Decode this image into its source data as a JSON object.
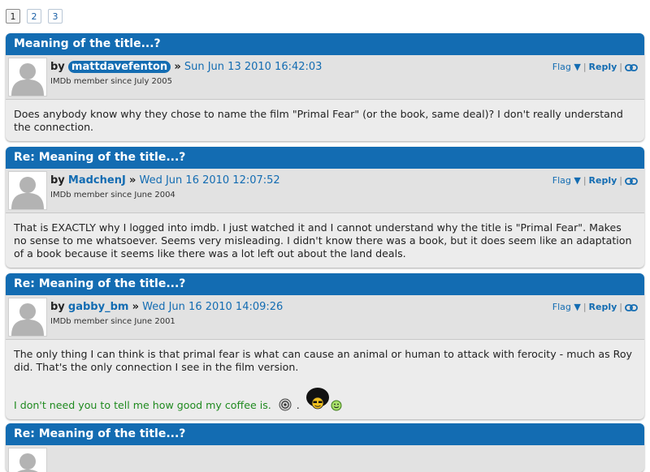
{
  "pagination": {
    "pages": [
      "1",
      "2",
      "3"
    ],
    "current": "1"
  },
  "actions": {
    "flag": "Flag ▼",
    "reply": "Reply",
    "divider": "|",
    "link_icon": "chain-link-icon"
  },
  "posts": [
    {
      "title": "Meaning of the title...?",
      "by": "by",
      "user": "mattdavefenton",
      "separator": "»",
      "date": "Sun Jun 13 2010 16:42:03",
      "member_since": "IMDb member since July 2005",
      "body": "Does anybody know why they chose to name the film \"Primal Fear\" (or the book, same deal)? I don't really understand the connection."
    },
    {
      "title": "Re: Meaning of the title...?",
      "by": "by",
      "user": "MadchenJ",
      "separator": "»",
      "date": "Wed Jun 16 2010 12:07:52",
      "member_since": "IMDb member since June 2004",
      "body": "That is EXACTLY why I logged into imdb. I just watched it and I cannot understand why the title is \"Primal Fear\". Makes no sense to me whatsoever. Seems very misleading. I didn't know there was a book, but it does seem like an adaptation of a book because it seems like there was a lot left out about the land deals."
    },
    {
      "title": "Re: Meaning of the title...?",
      "by": "by",
      "user": "gabby_bm",
      "separator": "»",
      "date": "Wed Jun 16 2010 14:09:26",
      "member_since": "IMDb member since June 2001",
      "body": "The only thing I can think is that primal fear is what can cause an animal or human to attack with ferocity - much as Roy did. That's the only connection I see in the film version.",
      "signature": "I don't need you to tell me how good my coffee is.",
      "signature_dot": "."
    },
    {
      "title": "Re: Meaning of the title...?"
    }
  ],
  "colors": {
    "header_blue": "#136cb2",
    "link_blue": "#136cb2",
    "signature_green": "#1f8a1f",
    "post_bg": "#ececec"
  }
}
